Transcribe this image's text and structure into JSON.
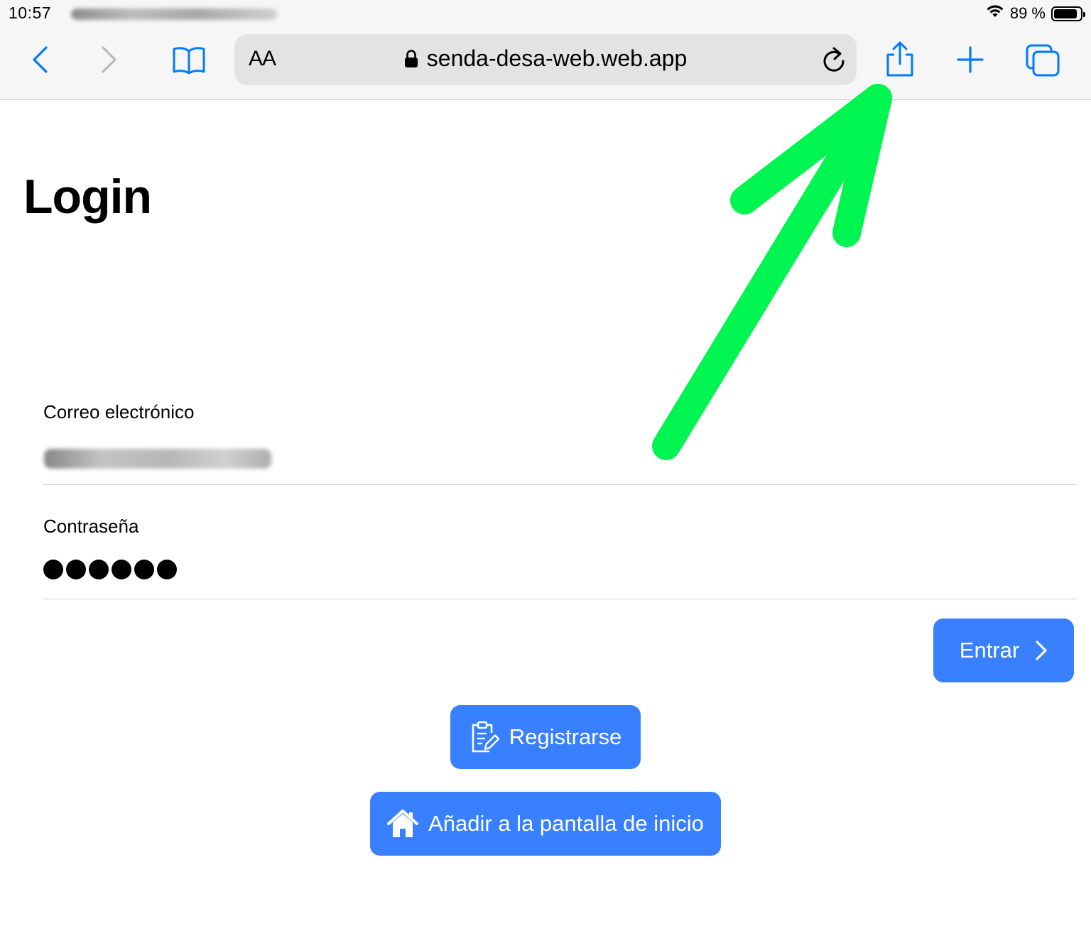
{
  "status_bar": {
    "time": "10:57",
    "battery_percent": "89 %",
    "battery_level": 0.89
  },
  "toolbar": {
    "text_size_label": "AA",
    "url": "senda-desa-web.web.app"
  },
  "page": {
    "title": "Login",
    "email_label": "Correo electrónico",
    "password_label": "Contraseña",
    "enter_button": "Entrar",
    "register_button": "Registrarse",
    "add_home_button": "Añadir a la pantalla de inicio"
  },
  "colors": {
    "ios_blue": "#007aff",
    "button_blue": "#3880ff",
    "annotation_green": "#00f550"
  },
  "icons": {
    "back": "chevron-left-icon",
    "forward": "chevron-right-icon",
    "bookmarks": "book-icon",
    "lock": "lock-icon",
    "reload": "reload-icon",
    "share": "share-icon",
    "new_tab": "plus-icon",
    "tabs": "tabs-icon",
    "register": "clipboard-edit-icon",
    "home": "house-icon",
    "annotation": "green-arrow-icon"
  }
}
